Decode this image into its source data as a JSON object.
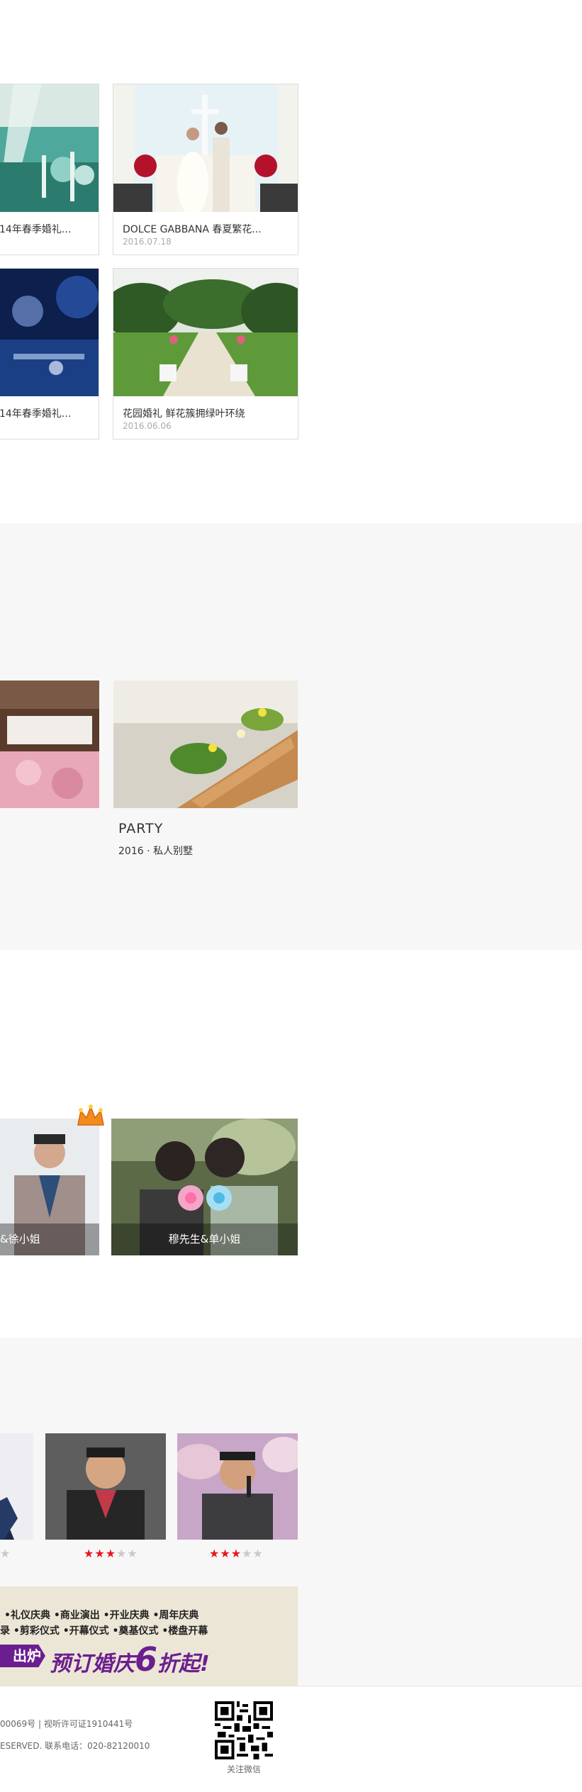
{
  "cases": [
    {
      "title": "14年春季婚礼...",
      "date": ""
    },
    {
      "title": "DOLCE GABBANA 春夏繁花...",
      "date": "2016.07.18"
    },
    {
      "title": "14年春季婚礼...",
      "date": ""
    },
    {
      "title": "花园婚礼 鲜花簇拥绿叶环绕",
      "date": "2016.06.06"
    }
  ],
  "party": {
    "title": "PARTY",
    "subtitle": "2016 · 私人别墅"
  },
  "couples": [
    {
      "name": "&徐小姐"
    },
    {
      "name": "穆先生&单小姐"
    }
  ],
  "hosts": {
    "ratings": [
      {
        "on": 0,
        "off": 1
      },
      {
        "on": 3,
        "off": 2
      },
      {
        "on": 3,
        "off": 2
      }
    ],
    "star_glyph": "★"
  },
  "banner": {
    "line1": "•礼仪庆典  •商业演出  •开业庆典  •周年庆典",
    "line2": "录  •剪彩仪式  •开幕仪式  •奠基仪式  •楼盘开幕",
    "tag": "出炉",
    "headline_a": "预订婚庆",
    "headline_num": "6",
    "headline_b": "折起!"
  },
  "footer": {
    "license": "00069号 | 视听许可证1910441号",
    "rights": "ESERVED. 联系电话：020-82120010",
    "qr_label": "关注微信"
  },
  "colors": {
    "accent_red": "#e8151f",
    "band_gray": "#f7f7f7",
    "banner_purple": "#6b1e8f"
  }
}
